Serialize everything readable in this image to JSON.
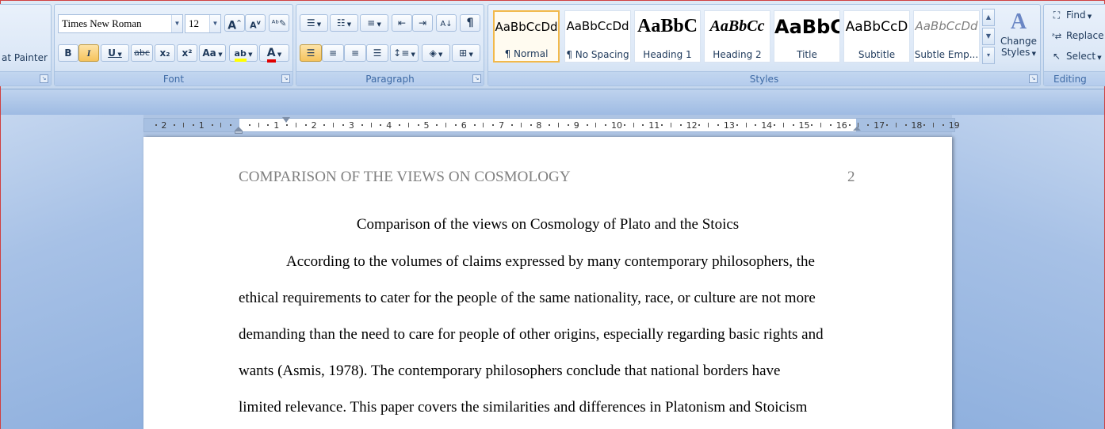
{
  "ribbon": {
    "clipboard": {
      "format_painter_label": "at Painter"
    },
    "font": {
      "group_label": "Font",
      "font_name": "Times New Roman",
      "font_size": "12",
      "grow_font": "A",
      "shrink_font": "A",
      "bold": "B",
      "italic": "I",
      "underline": "U",
      "strikethrough": "abc",
      "subscript": "x₂",
      "superscript": "x²",
      "change_case": "Aa",
      "highlight_color": "#ffff00",
      "font_color": "#e00000"
    },
    "paragraph": {
      "group_label": "Paragraph",
      "show_marks": "¶"
    },
    "styles": {
      "group_label": "Styles",
      "items": [
        {
          "sample": "AaBbCcDd",
          "name": "¶ Normal"
        },
        {
          "sample": "AaBbCcDd",
          "name": "¶ No Spacing"
        },
        {
          "sample": "AaBbC",
          "name": "Heading 1"
        },
        {
          "sample": "AaBbCc",
          "name": "Heading 2"
        },
        {
          "sample": "AaBbC",
          "name": "Title"
        },
        {
          "sample": "AaBbCcD",
          "name": "Subtitle"
        },
        {
          "sample": "AaBbCcDd",
          "name": "Subtle Emp..."
        }
      ],
      "change_styles_line1": "Change",
      "change_styles_line2": "Styles"
    },
    "editing": {
      "group_label": "Editing",
      "find": "Find",
      "replace": "Replace",
      "select": "Select"
    }
  },
  "ruler": {
    "labels": [
      "2",
      "1",
      "1",
      "2",
      "3",
      "4",
      "5",
      "6",
      "7",
      "8",
      "9",
      "10",
      "11",
      "12",
      "13",
      "14",
      "15",
      "16",
      "17",
      "18",
      "19"
    ]
  },
  "document": {
    "header": "COMPARISON OF THE VIEWS ON COSMOLOGY",
    "page_number": "2",
    "title": "Comparison of the views on Cosmology of Plato and the Stoics",
    "lines": [
      "According to the volumes of claims expressed by many contemporary philosophers, the",
      "ethical requirements to cater for the people of the same nationality, race, or culture are not more",
      "demanding than the need to care for people of other origins, especially regarding basic rights and",
      "wants (Asmis, 1978). The contemporary philosophers conclude that national borders have",
      "limited relevance. This paper covers the similarities and differences in Platonism and Stoicism"
    ]
  }
}
